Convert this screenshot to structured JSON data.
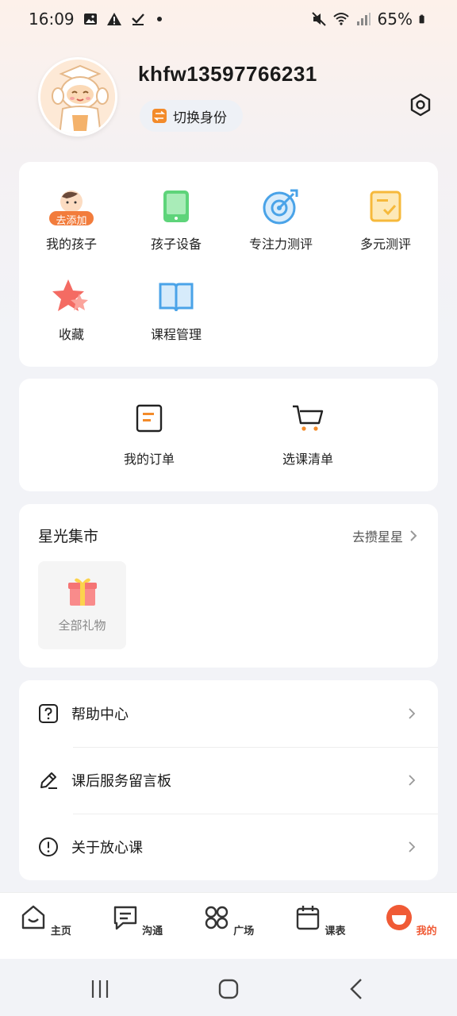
{
  "status_bar": {
    "time": "16:09",
    "battery": "65%"
  },
  "profile": {
    "username": "khfw13597766231",
    "switch_label": "切换身份"
  },
  "features": {
    "add_badge": "去添加",
    "items": [
      {
        "label": "我的孩子",
        "icon": "child-icon"
      },
      {
        "label": "孩子设备",
        "icon": "tablet-icon"
      },
      {
        "label": "专注力测评",
        "icon": "target-icon"
      },
      {
        "label": "多元测评",
        "icon": "assessment-icon"
      },
      {
        "label": "收藏",
        "icon": "star-icon"
      },
      {
        "label": "课程管理",
        "icon": "book-icon"
      }
    ]
  },
  "orders": {
    "items": [
      {
        "label": "我的订单",
        "icon": "order-icon"
      },
      {
        "label": "选课清单",
        "icon": "cart-icon"
      }
    ]
  },
  "market": {
    "title": "星光集市",
    "link": "去攒星星",
    "gift_label": "全部礼物"
  },
  "menu": {
    "items": [
      {
        "label": "帮助中心",
        "icon": "help-icon"
      },
      {
        "label": "课后服务留言板",
        "icon": "edit-icon"
      },
      {
        "label": "关于放心课",
        "icon": "info-icon"
      }
    ]
  },
  "tabbar": {
    "items": [
      {
        "label": "主页"
      },
      {
        "label": "沟通"
      },
      {
        "label": "广场"
      },
      {
        "label": "课表"
      },
      {
        "label": "我的"
      }
    ]
  },
  "colors": {
    "accent": "#f05a35",
    "orange": "#f38b2a",
    "blue": "#4aa3e8",
    "green": "#5ed47a"
  }
}
